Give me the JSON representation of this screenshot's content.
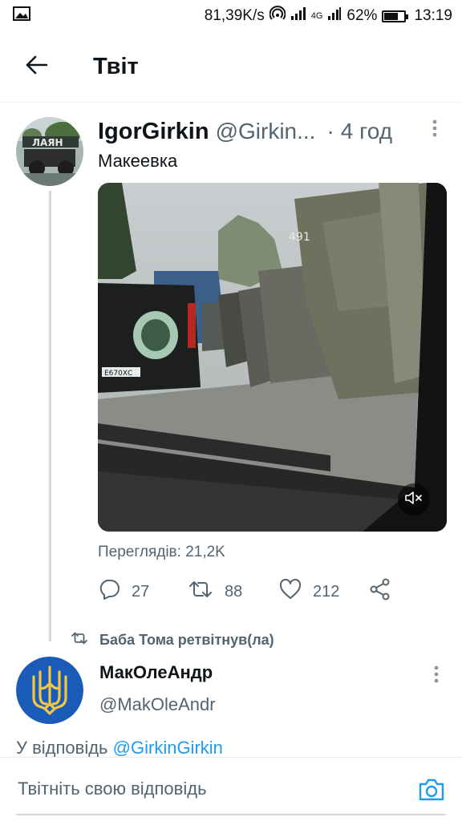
{
  "status_bar": {
    "speed": "81,39K/s",
    "network": "4G",
    "battery": "62%",
    "battery_level": 0.62,
    "time": "13:19"
  },
  "header": {
    "title": "Твіт"
  },
  "tweet": {
    "author_name": "IgorGirkin",
    "author_handle": "@Girkin...",
    "separator": "·",
    "time_ago": "4 год",
    "text": "Макеевка",
    "media_truck_number": "491",
    "media_plate": "Е670ХС",
    "views_label": "Переглядів: 21,2K",
    "replies": "27",
    "retweets": "88",
    "likes": "212"
  },
  "retweet_notice": "Баба Тома ретвітнув(ла)",
  "reply_tweet": {
    "author_name": "МакОлеАндр",
    "author_handle": "@MakOleAndr",
    "reply_prefix": "У відповідь",
    "reply_mention": "@GirkinGirkin"
  },
  "composer": {
    "placeholder": "Твітніть свою відповідь"
  },
  "colors": {
    "accent": "#1d9bf0",
    "secondary_text": "#536471",
    "trident_bg": "#1a5bb8",
    "trident": "#f2c744"
  },
  "icons": [
    "image-icon",
    "hotspot-icon",
    "signal-icon",
    "battery-icon",
    "back-arrow-icon",
    "more-icon",
    "mute-icon",
    "reply-icon",
    "retweet-icon",
    "like-icon",
    "share-icon",
    "camera-icon"
  ]
}
